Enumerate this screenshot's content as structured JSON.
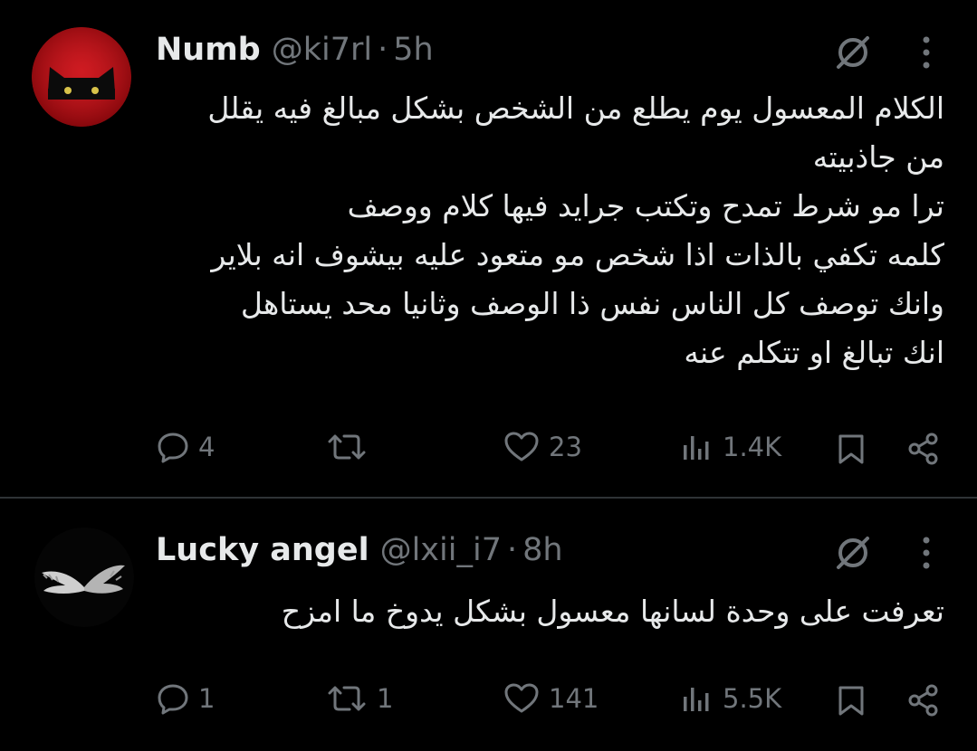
{
  "tweets": [
    {
      "name": "Numb",
      "handle": "@ki7rl",
      "dot": "·",
      "time": "5h",
      "lines": [
        "الكلام المعسول يوم يطلع من الشخص بشكل مبالغ فيه يقلل",
        "من جاذبيته",
        "ترا مو شرط تمدح وتكتب جرايد فيها كلام ووصف",
        "كلمه تكفي بالذات اذا شخص مو متعود عليه بيشوف انه بلاير",
        "وانك توصف كل الناس نفس ذا الوصف وثانيا محد يستاهل",
        "انك تبالغ او تتكلم عنه"
      ],
      "replies": "4",
      "reposts": "",
      "likes": "23",
      "views": "1.4K"
    },
    {
      "name": "Lucky angel",
      "handle": "@lxii_i7",
      "dot": "·",
      "time": "8h",
      "lines": [
        "تعرفت على وحدة لسانها معسول بشكل يدوخ ما امزح"
      ],
      "replies": "1",
      "reposts": "1",
      "likes": "141",
      "views": "5.5K"
    }
  ],
  "icons": {
    "reply": "reply-icon",
    "repost": "repost-icon",
    "like": "like-icon",
    "views": "views-icon",
    "bookmark": "bookmark-icon",
    "share": "share-icon",
    "grok": "grok-icon",
    "more": "more-icon"
  },
  "colors": {
    "background": "#000000",
    "text": "#e7e9ea",
    "muted": "#71767b",
    "divider": "#2f3336",
    "avatar_red": "#c4161c"
  }
}
